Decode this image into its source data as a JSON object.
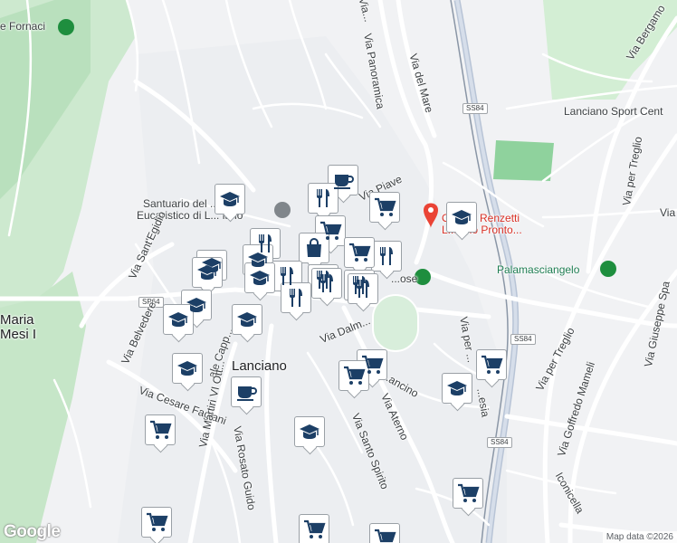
{
  "map": {
    "labels": {
      "fornaci": "e Fornaci",
      "via_panoramica": "Via Panoramica",
      "via_del_mare": "Via del Mare",
      "ss84_top": "SS84",
      "ss84_mid": "SS84",
      "ss84_bot": "SS84",
      "sp64": "SP64",
      "via_bergamo": "Via Bergamo",
      "lanciano_sport": "Lanciano Sport Cent",
      "santuario": "Santuario del ... olo\nEucaristico di L... iano",
      "via_piave": "Via Piave",
      "ospedale": "O... ale Renzetti\nL... ano Pronto...",
      "via_per_treglio_top": "Via per Treglio",
      "via_gi": "Via Gi",
      "via_sant_egidio": "Via Sant'Egidio",
      "palamasciangelo": "Palamasciangelo",
      "maria_mesi": "Maria\nMesi I",
      "via_belvedere": "Via Belvedere",
      "via_cappuccini": "ale Capp...",
      "via_dalmazia": "Via Dalm...",
      "via_per_fossa": "Via per ...",
      "ss84_mid2": "SS84",
      "via_giuseppe": "Via Giuseppe Spa",
      "via_per_treglio_bot": "Via per Treglio",
      "lanciano": "Lanciano",
      "via_mancino": "...ancino",
      "via_cesare_fagiani": "Via Cesare Fagiani",
      "via_martiri": "Via Martiri VI Ott...",
      "via_aterno": "Via Aterno",
      "via_sesia": "...esia",
      "via_goffredo": "Via Goffredo Mameli",
      "via_santo_spirito": "Via Santo Spirito",
      "via_rosato_guido": "Via Rosato Guido",
      "iconicella": "Iconicella",
      "via_rose": "...ose",
      "via_v_top": "Via..."
    },
    "google_logo": "Google",
    "attribution": "Map data ©2026"
  },
  "markers": [
    {
      "type": "cafe",
      "label": "cafe"
    },
    {
      "type": "restaurant",
      "label": "restaurant"
    },
    {
      "type": "school",
      "label": "school"
    },
    {
      "type": "shopping",
      "label": "shopping"
    },
    {
      "type": "grocery",
      "label": "grocery"
    }
  ],
  "colors": {
    "water_land": "#f1f2f4",
    "park": "#bfe8c6",
    "dark_park": "#a5d6a7",
    "road": "#ffffff",
    "highway": "#c9d3e3",
    "rail": "#7f8b99",
    "icon": "#1c3f66",
    "hospital": "#ea4335",
    "green_poi": "#1e8e3e"
  }
}
